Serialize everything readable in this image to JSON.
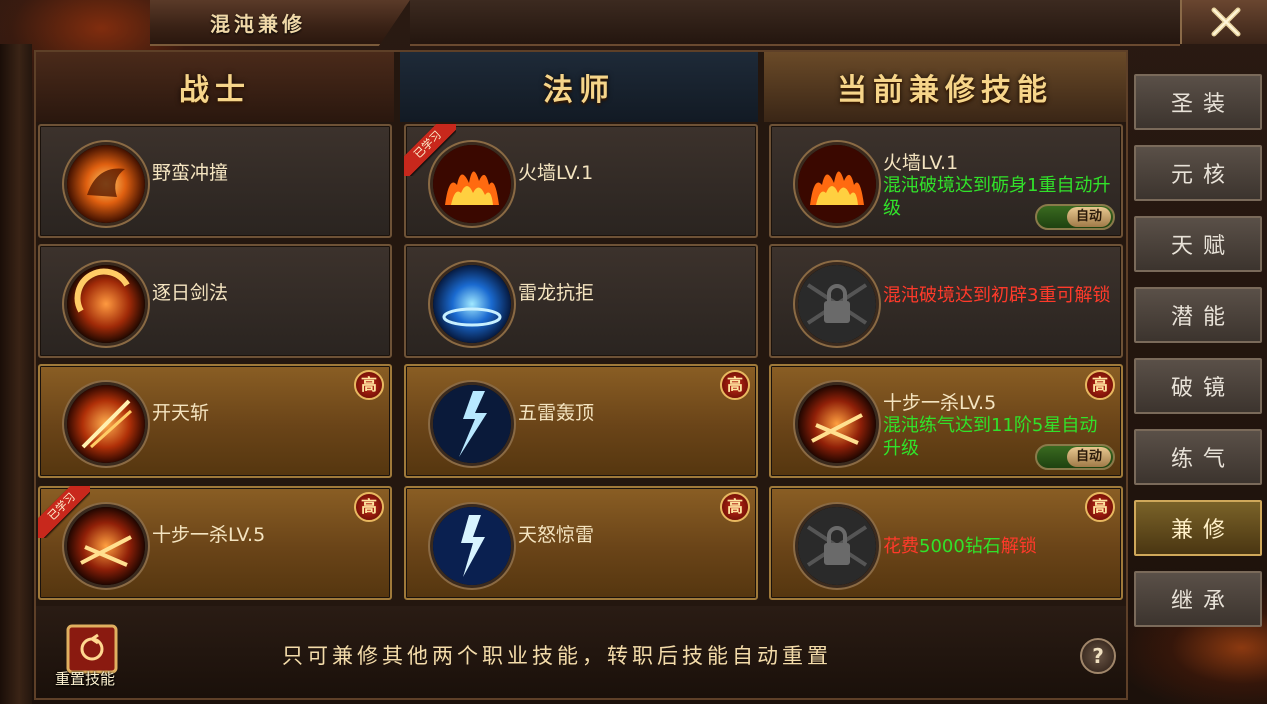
{
  "window": {
    "title": "混沌兼修"
  },
  "columns": {
    "warrior": {
      "title": "战士"
    },
    "mage": {
      "title": "法师"
    },
    "current": {
      "title": "当前兼修技能"
    }
  },
  "warrior_skills": [
    {
      "name": "野蛮冲撞",
      "icon": "charge-icon",
      "high": false,
      "learned": false
    },
    {
      "name": "逐日剑法",
      "icon": "sun-sword-icon",
      "high": false,
      "learned": false
    },
    {
      "name": "开天斩",
      "icon": "sky-slash-icon",
      "high": true,
      "high_label": "高",
      "learned": false
    },
    {
      "name": "十步一杀LV.5",
      "icon": "ten-step-kill-icon",
      "high": true,
      "high_label": "高",
      "learned": true,
      "learned_label": "已学习"
    }
  ],
  "mage_skills": [
    {
      "name": "火墙LV.1",
      "icon": "fire-wall-icon",
      "high": false,
      "learned": true,
      "learned_label": "已学习"
    },
    {
      "name": "雷龙抗拒",
      "icon": "thunder-dragon-icon",
      "high": false,
      "learned": false
    },
    {
      "name": "五雷轰顶",
      "icon": "five-thunder-icon",
      "high": true,
      "high_label": "高",
      "learned": false
    },
    {
      "name": "天怒惊雷",
      "icon": "heaven-thunder-icon",
      "high": true,
      "high_label": "高",
      "learned": false
    }
  ],
  "current_skills": [
    {
      "name": "火墙LV.1",
      "desc": "混沌破境达到砺身1重自动升级",
      "auto_label": "自动"
    },
    {
      "lock_text": "混沌破境达到初辟3重可解锁"
    },
    {
      "name": "十步一杀LV.5",
      "desc": "混沌练气达到11阶5星自动升级",
      "auto_label": "自动",
      "high_label": "高"
    },
    {
      "cost_prefix": "花费",
      "cost_amount": "5000钻石",
      "cost_suffix": "解锁",
      "high_label": "高"
    }
  ],
  "side_tabs": [
    "圣装",
    "元核",
    "天赋",
    "潜能",
    "破镜",
    "练气",
    "兼修",
    "继承"
  ],
  "active_tab": "兼修",
  "bottom": {
    "reset_label": "重置技能",
    "tip": "只可兼修其他两个职业技能，转职后技能自动重置",
    "help_label": "?"
  },
  "colors": {
    "gold_title": "#f6d58a",
    "green_text": "#31e22a",
    "red_text": "#ff3a2a"
  }
}
